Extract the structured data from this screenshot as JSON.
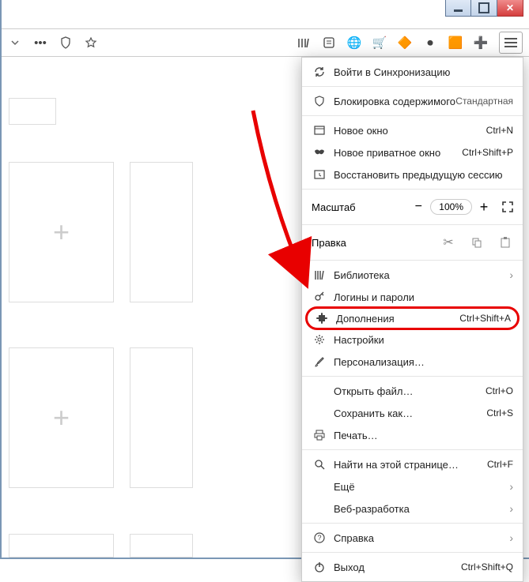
{
  "window": {
    "buttons": [
      "minimize",
      "maximize",
      "close"
    ]
  },
  "toolbar": {
    "extensions": [
      "library",
      "reader",
      "theme",
      "cart",
      "profile",
      "record",
      "note",
      "plus"
    ]
  },
  "zoom": {
    "label": "Масштаб",
    "value": "100%"
  },
  "edit": {
    "label": "Правка"
  },
  "menu": {
    "sync": "Войти в Синхронизацию",
    "block": {
      "label": "Блокировка содержимого",
      "status": "Стандартная"
    },
    "new_window": {
      "label": "Новое окно",
      "short": "Ctrl+N"
    },
    "new_private": {
      "label": "Новое приватное окно",
      "short": "Ctrl+Shift+P"
    },
    "restore": "Восстановить предыдущую сессию",
    "library": "Библиотека",
    "logins": "Логины и пароли",
    "addons": {
      "label": "Дополнения",
      "short": "Ctrl+Shift+A"
    },
    "settings": "Настройки",
    "personalize": "Персонализация…",
    "open_file": {
      "label": "Открыть файл…",
      "short": "Ctrl+O"
    },
    "save_as": {
      "label": "Сохранить как…",
      "short": "Ctrl+S"
    },
    "print": "Печать…",
    "find": {
      "label": "Найти на этой странице…",
      "short": "Ctrl+F"
    },
    "more": "Ещё",
    "webdev": "Веб-разработка",
    "help": "Справка",
    "exit": {
      "label": "Выход",
      "short": "Ctrl+Shift+Q"
    }
  }
}
